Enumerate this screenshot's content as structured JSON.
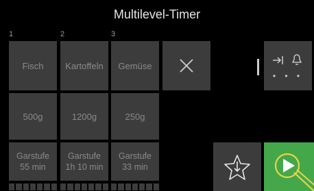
{
  "header": {
    "title": "Multilevel-Timer"
  },
  "columns": [
    {
      "num": "1",
      "food": "Fisch",
      "weight": "500g",
      "level_line1": "Garstufe",
      "level_line2": "55 min"
    },
    {
      "num": "2",
      "food": "Kartoffeln",
      "weight": "1200g",
      "level_line1": "Garstufe",
      "level_line2": "1h 10 min"
    },
    {
      "num": "3",
      "food": "Gemüse",
      "weight": "250g",
      "level_line1": "Garstufe",
      "level_line2": "33 min"
    }
  ],
  "controls": {
    "close_icon": "close-icon",
    "side_icons": [
      "skip-to-end-icon",
      "bell-icon"
    ],
    "more_dots": "• • •",
    "favorite_icon": "star-add-icon",
    "start_icon": "play-timer-icon"
  },
  "colors": {
    "background": "#000000",
    "tile": "#3c3c3c",
    "tile_text": "#8a8a8a",
    "accent_green": "#44a84a",
    "accent_yellow": "#e8d44a"
  }
}
